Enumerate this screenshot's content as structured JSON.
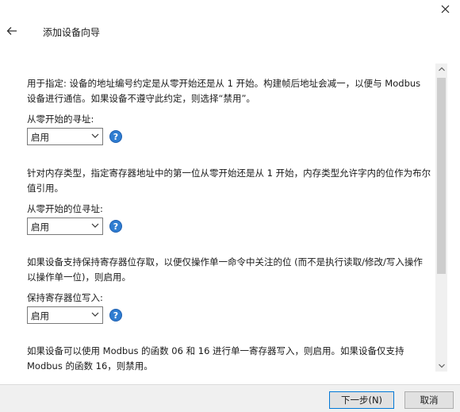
{
  "header": {
    "title": "添加设备向导"
  },
  "sections": [
    {
      "description": "用于指定: 设备的地址编号约定是从零开始还是从 1 开始。构建帧后地址会减一，以便与 Modbus 设备进行通信。如果设备不遵守此约定，则选择“禁用”。",
      "field_label": "从零开始的寻址:",
      "value": "启用",
      "help": "?"
    },
    {
      "description": "针对内存类型，指定寄存器地址中的第一位从零开始还是从 1 开始，内存类型允许字内的位作为布尔值引用。",
      "field_label": "从零开始的位寻址:",
      "value": "启用",
      "help": "?"
    },
    {
      "description": "如果设备支持保持寄存器位存取，以便仅操作单一命令中关注的位 (而不是执行读取/修改/写入操作以操作单一位)，则启用。",
      "field_label": "保持寄存器位写入:",
      "value": "启用",
      "help": "?"
    },
    {
      "description": "如果设备可以使用 Modbus 的函数 06 和 16 进行单一寄存器写入，则启用。如果设备仅支持 Modbus 的函数 16，则禁用。"
    }
  ],
  "footer": {
    "next_label": "下一步(N)",
    "cancel_label": "取消"
  },
  "icons": {
    "back": "arrow-left-icon",
    "close": "close-icon",
    "dropdown": "chevron-down-icon",
    "help": "help-icon"
  },
  "colors": {
    "help_icon": "#2f7dd1",
    "primary_border": "#0078d7",
    "footer_bg": "#f0f0f0"
  }
}
